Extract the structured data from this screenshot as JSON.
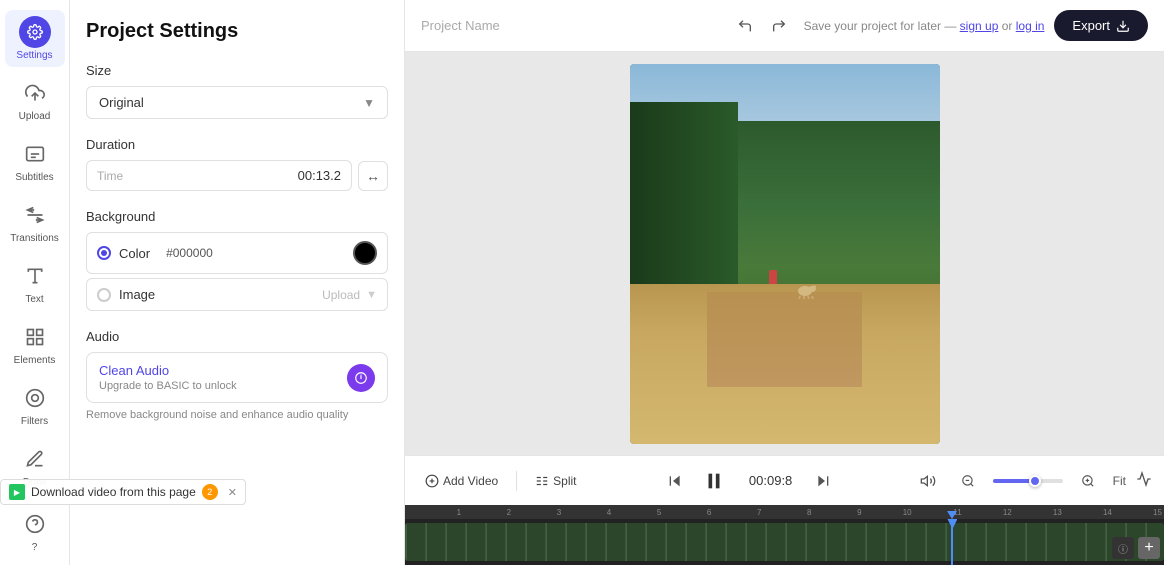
{
  "sidebar": {
    "items": [
      {
        "id": "settings",
        "label": "Settings",
        "active": true
      },
      {
        "id": "upload",
        "label": "Upload"
      },
      {
        "id": "subtitles",
        "label": "Subtitles"
      },
      {
        "id": "transitions",
        "label": "Transitions"
      },
      {
        "id": "text",
        "label": "Text"
      },
      {
        "id": "elements",
        "label": "Elements"
      },
      {
        "id": "filters",
        "label": "Filters"
      },
      {
        "id": "draw",
        "label": "Draw"
      },
      {
        "id": "help",
        "label": "?"
      }
    ]
  },
  "settings_panel": {
    "title": "Project Settings",
    "size_section": {
      "label": "Size",
      "selected": "Original"
    },
    "duration_section": {
      "label": "Duration",
      "time_label": "Time",
      "value": "00:13.2"
    },
    "background_section": {
      "label": "Background",
      "color_option": "Color",
      "color_hex": "#000000",
      "image_option": "Image",
      "upload_label": "Upload"
    },
    "audio_section": {
      "label": "Audio",
      "audio_title": "Clean Audio",
      "audio_subtitle": "Upgrade to BASIC to unlock",
      "audio_hint": "Remove background noise and enhance audio quality"
    }
  },
  "topbar": {
    "project_name_placeholder": "Project Name",
    "save_text_prefix": "Save your project for later — ",
    "sign_up_label": "sign up",
    "or_label": "or",
    "log_in_label": "log in",
    "export_label": "Export"
  },
  "controls": {
    "add_video_label": "Add Video",
    "split_label": "Split",
    "timecode": "00:09:8",
    "fit_label": "Fit"
  },
  "download_banner": {
    "text": "Download video from this page",
    "badge_number": "2"
  },
  "ruler_marks": [
    "1",
    "2",
    "3",
    "4",
    "5",
    "6",
    "7",
    "8",
    "9",
    "10",
    "11",
    "12",
    "13",
    "14",
    "15"
  ]
}
